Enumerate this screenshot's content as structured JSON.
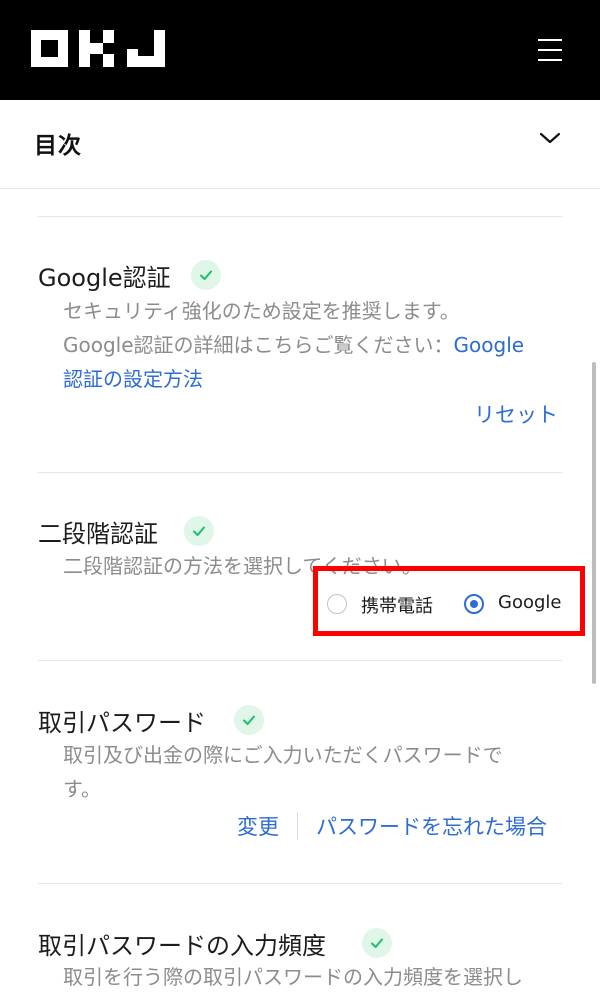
{
  "header": {
    "logo_text": "OKJ",
    "menu_icon": "hamburger-menu-icon"
  },
  "toc": {
    "title": "目次",
    "chevron_icon": "chevron-down-icon"
  },
  "sections": {
    "google_auth": {
      "title": "Google認証",
      "desc_line1": "セキュリティ強化のため設定を推奨します。",
      "desc_line2_prefix": "Google認証の詳細はこちらご覧ください：",
      "desc_line2_link": "Google",
      "desc_line3_link": "認証の設定方法",
      "reset_label": "リセット"
    },
    "two_factor": {
      "title": "二段階認証",
      "desc": "二段階認証の方法を選択してください。",
      "options": [
        "携帯電話",
        "Google"
      ],
      "selected": "Google"
    },
    "trade_password": {
      "title": "取引パスワード",
      "desc_line1": "取引及び出金の際にご入力いただくパスワードで",
      "desc_line2": "す。",
      "change_label": "変更",
      "forgot_label": "パスワードを忘れた場合"
    },
    "trade_password_frequency": {
      "title": "取引パスワードの入力頻度",
      "desc_line1": "取引を行う際の取引パスワードの入力頻度を選択し"
    }
  },
  "colors": {
    "accent": "#2d6bd6",
    "check_bg": "#dff6e9",
    "check_mark": "#1fbf6a",
    "highlight": "#ff0000"
  }
}
